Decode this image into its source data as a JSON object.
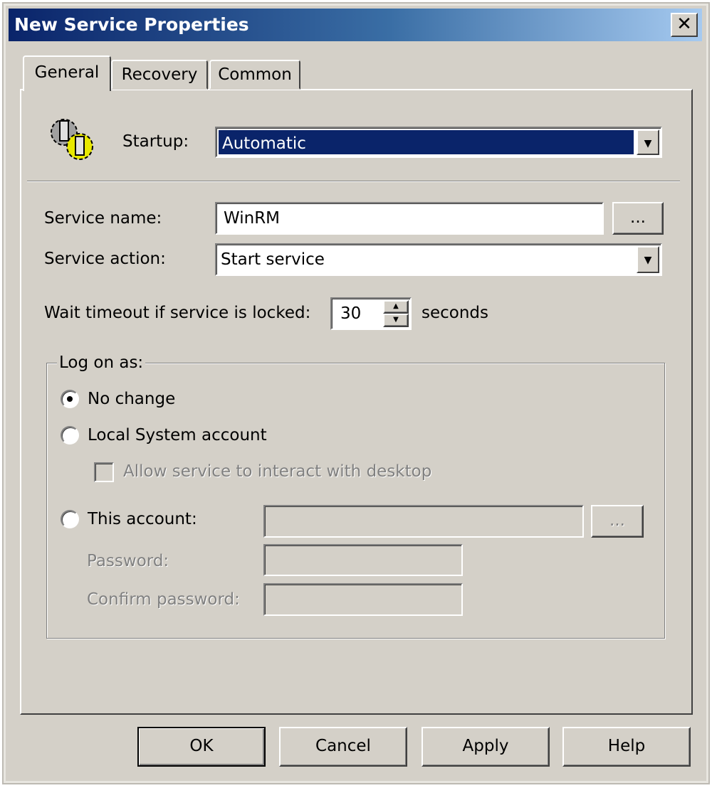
{
  "window": {
    "title": "New Service Properties",
    "close_label": "✕"
  },
  "tabs": [
    {
      "label": "General",
      "selected": true
    },
    {
      "label": "Recovery"
    },
    {
      "label": "Common"
    }
  ],
  "general": {
    "startup_label": "Startup:",
    "startup_value": "Automatic",
    "service_name_label": "Service name:",
    "service_name_value": "WinRM",
    "browse_label": "...",
    "service_action_label": "Service action:",
    "service_action_value": "Start service",
    "wait_label": "Wait timeout if service is locked:",
    "wait_value": "30",
    "wait_unit": "seconds",
    "logon": {
      "legend": "Log on as:",
      "no_change": "No change",
      "local_system": "Local System account",
      "interact": "Allow service to interact with desktop",
      "this_account": "This account:",
      "browse_label": "...",
      "password_label": "Password:",
      "confirm_label": "Confirm password:",
      "selected": "No change"
    }
  },
  "buttons": {
    "ok": "OK",
    "cancel": "Cancel",
    "apply": "Apply",
    "help": "Help"
  },
  "colors": {
    "title_start": "#0a246a",
    "title_end": "#a6caf0",
    "selection": "#0a246a",
    "face": "#d4d0c8"
  }
}
